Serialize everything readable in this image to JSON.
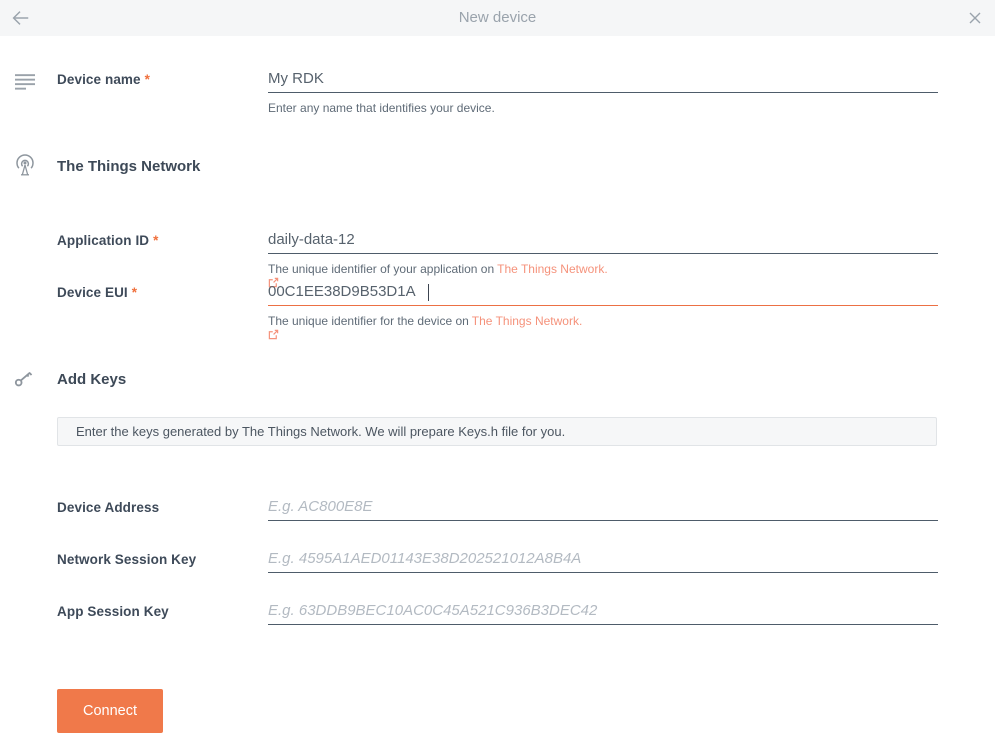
{
  "header": {
    "title": "New device"
  },
  "sections": {
    "ttn": {
      "title": "The Things Network"
    },
    "add_keys": {
      "title": "Add Keys"
    }
  },
  "fields": {
    "device_name": {
      "label": "Device name",
      "required": "*",
      "value": "My RDK",
      "helper": "Enter any name that identifies your device."
    },
    "application_id": {
      "label": "Application ID",
      "required": "*",
      "value": "daily-data-12",
      "helper_prefix": "The unique identifier of your application on",
      "helper_link": "The Things Network."
    },
    "device_eui": {
      "label": "Device EUI",
      "required": "*",
      "value": "00C1EE38D9B53D1A",
      "helper_prefix": "The unique identifier for the device on",
      "helper_link": "The Things Network."
    },
    "device_address": {
      "label": "Device Address",
      "placeholder": "E.g. AC800E8E"
    },
    "network_session_key": {
      "label": "Network Session Key",
      "placeholder": "E.g. 4595A1AED01143E38D202521012A8B4A"
    },
    "app_session_key": {
      "label": "App Session Key",
      "placeholder": "E.g. 63DDB9BEC10AC0C45A521C936B3DEC42"
    }
  },
  "info_box": {
    "text": "Enter the keys generated by The Things Network. We will prepare Keys.h file for you."
  },
  "actions": {
    "connect": "Connect"
  },
  "colors": {
    "accent": "#f0794a",
    "link": "#f5927b",
    "focused_underline": "#ec7044",
    "header_bg": "#f5f6f7",
    "icon_gray": "#8e969e"
  }
}
